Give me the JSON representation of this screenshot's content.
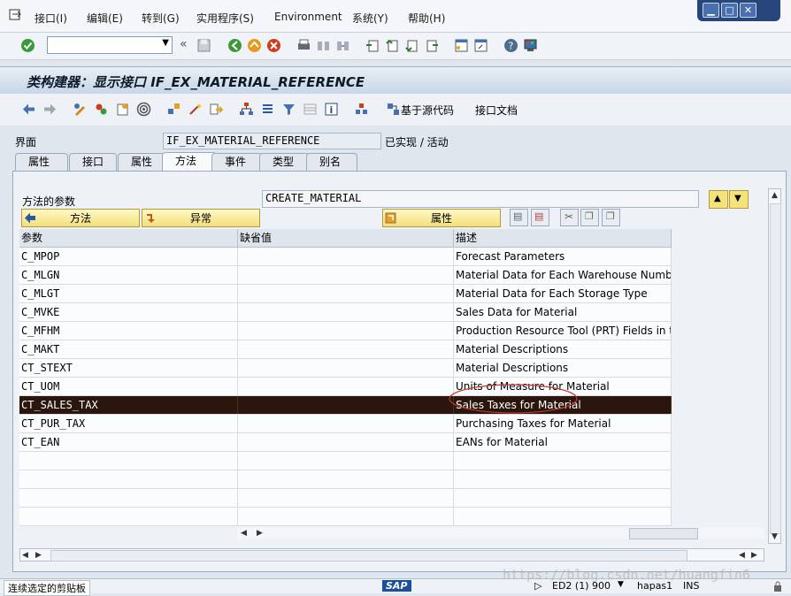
{
  "menubar": {
    "items": [
      "接口(I)",
      "编辑(E)",
      "转到(G)",
      "实用程序(S)",
      "Environment",
      "系统(Y)",
      "帮助(H)"
    ]
  },
  "window_controls": [
    "▁",
    "□",
    "✕"
  ],
  "toolbar": {
    "command_value": "",
    "icons": [
      "enter-icon",
      "back-arrows-icon",
      "save-icon",
      "back-icon",
      "exit-icon",
      "cancel-icon",
      "print-icon",
      "find-icon",
      "find-next-icon",
      "first-page-icon",
      "prev-page-icon",
      "next-page-icon",
      "last-page-icon",
      "new-session-icon",
      "shortcut-icon",
      "help-icon",
      "layout-icon"
    ]
  },
  "title": "类构建器：显示接口 IF_EX_MATERIAL_REFERENCE",
  "toolbar2": {
    "source_button": "基于源代码",
    "doc_button": "接口文档"
  },
  "header": {
    "interface_label": "界面",
    "interface_value": "IF_EX_MATERIAL_REFERENCE",
    "status": "已实现 / 活动"
  },
  "tabs": [
    "属性",
    "接口",
    "属性",
    "方法",
    "事件",
    "类型",
    "别名"
  ],
  "active_tab": 3,
  "method": {
    "label": "方法的参数",
    "value": "CREATE_MATERIAL"
  },
  "buttons": {
    "method": "方法",
    "exception": "异常",
    "attribute": "属性"
  },
  "table": {
    "columns": [
      "参数",
      "缺省值",
      "描述"
    ],
    "rows": [
      {
        "param": "C_MPOP",
        "default": "",
        "desc": "Forecast Parameters"
      },
      {
        "param": "C_MLGN",
        "default": "",
        "desc": "Material Data for Each Warehouse Number"
      },
      {
        "param": "C_MLGT",
        "default": "",
        "desc": "Material Data for Each Storage Type"
      },
      {
        "param": "C_MVKE",
        "default": "",
        "desc": "Sales Data for Material"
      },
      {
        "param": "C_MFHM",
        "default": "",
        "desc": "Production Resource Tool (PRT) Fields in t..."
      },
      {
        "param": "C_MAKT",
        "default": "",
        "desc": "Material Descriptions"
      },
      {
        "param": "CT_STEXT",
        "default": "",
        "desc": "Material Descriptions"
      },
      {
        "param": "CT_UOM",
        "default": "",
        "desc": "Units of Measure for Material"
      },
      {
        "param": "CT_SALES_TAX",
        "default": "",
        "desc": "Sales Taxes for Material"
      },
      {
        "param": "CT_PUR_TAX",
        "default": "",
        "desc": "Purchasing Taxes for Material"
      },
      {
        "param": "CT_EAN",
        "default": "",
        "desc": "EANs for Material"
      },
      {
        "param": "",
        "default": "",
        "desc": ""
      },
      {
        "param": "",
        "default": "",
        "desc": ""
      },
      {
        "param": "",
        "default": "",
        "desc": ""
      },
      {
        "param": "",
        "default": "",
        "desc": ""
      }
    ],
    "selected_index": 8
  },
  "status_bar": {
    "clipboard": "连续选定的剪贴板",
    "logo": "SAP",
    "system": "ED2 (1) 900",
    "server": "hapas1",
    "mode": "INS"
  },
  "watermark": "https://blog.csdn.net/huangfin6"
}
